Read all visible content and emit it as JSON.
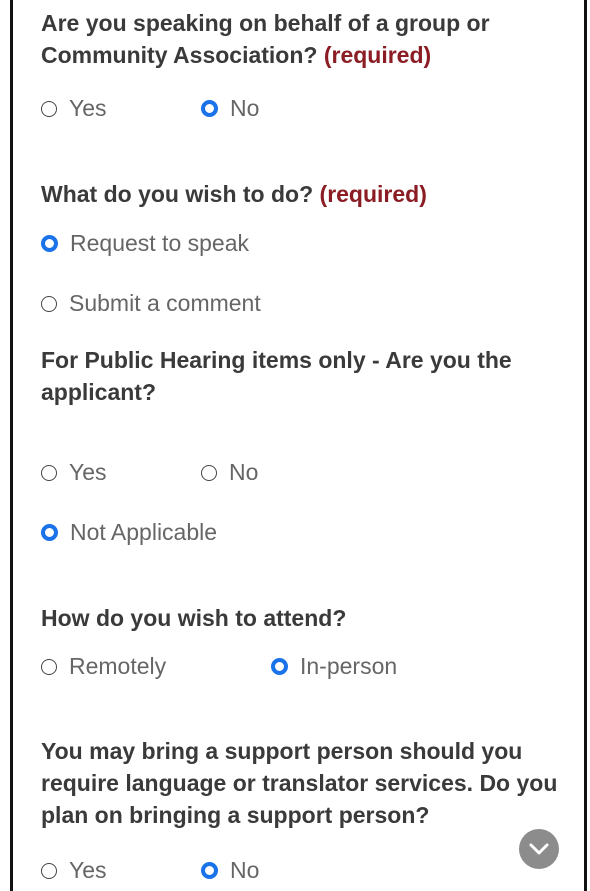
{
  "required_marker": "(required)",
  "q1": {
    "text": "Are you speaking on behalf of a group or Community Association?",
    "options": [
      "Yes",
      "No"
    ],
    "selected": "No"
  },
  "q2": {
    "text": "What do you wish to do?",
    "options": [
      "Request to speak",
      "Submit a comment"
    ],
    "selected": "Request to speak"
  },
  "q3": {
    "text": "For Public Hearing items only - Are you the applicant?",
    "options": [
      "Yes",
      "No",
      "Not Applicable"
    ],
    "selected": "Not Applicable"
  },
  "q4": {
    "text": "How do you wish to attend?",
    "options": [
      "Remotely",
      "In-person"
    ],
    "selected": "In-person"
  },
  "q5": {
    "text": "You may bring a support person should you require language or translator services. Do you plan on bringing a support person?",
    "options": [
      "Yes",
      "No"
    ],
    "selected": "No"
  },
  "scroll_icon": "chevron-down-icon",
  "colors": {
    "accent": "#1a73e8",
    "required": "#8b1c24",
    "scroll_button": "#8c8c8c"
  }
}
